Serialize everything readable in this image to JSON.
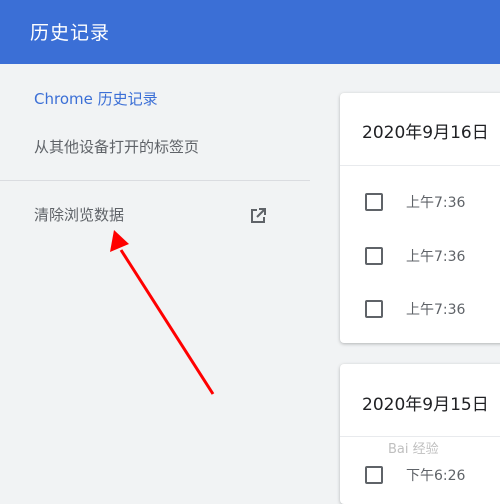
{
  "header": {
    "title": "历史记录"
  },
  "sidebar": {
    "items": [
      {
        "label": "Chrome 历史记录",
        "active": true
      },
      {
        "label": "从其他设备打开的标签页",
        "active": false
      }
    ],
    "clear_browsing_data": {
      "label": "清除浏览数据",
      "icon": "open-in-new-icon"
    }
  },
  "history": {
    "groups": [
      {
        "date": "2020年9月16日",
        "entries": [
          {
            "time": "上午7:36"
          },
          {
            "time": "上午7:36"
          },
          {
            "time": "上午7:36"
          }
        ]
      },
      {
        "date": "2020年9月15日",
        "entries": [
          {
            "time": "下午6:26"
          }
        ]
      }
    ]
  },
  "annotation": {
    "type": "red-arrow",
    "points_to": "clear-browsing-data"
  },
  "watermark": {
    "text": "Bai 经验"
  },
  "colors": {
    "header_bg": "#3b6fd6",
    "accent": "#3b6fd6",
    "arrow": "#ff0000"
  }
}
